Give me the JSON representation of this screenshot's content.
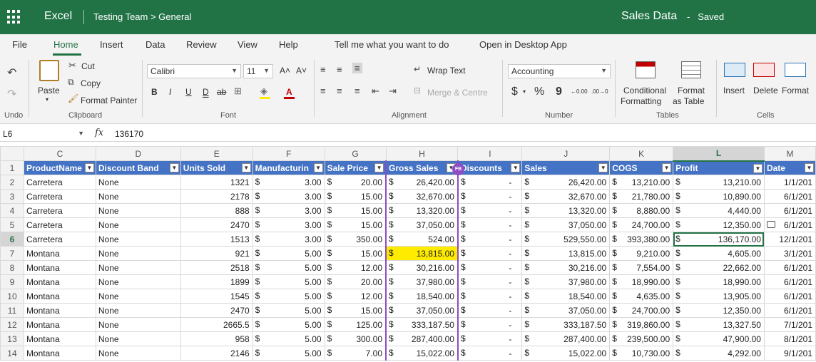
{
  "topbar": {
    "app_name": "Excel",
    "breadcrumb": "Testing Team > General",
    "doc_title": "Sales Data",
    "separator": "-",
    "status": "Saved"
  },
  "menu": {
    "tabs": [
      "File",
      "Home",
      "Insert",
      "Data",
      "Review",
      "View",
      "Help"
    ],
    "tell_me": "Tell me what you want to do",
    "open_desktop": "Open in Desktop App"
  },
  "ribbon": {
    "undo_label": "Undo",
    "paste": "Paste",
    "cut": "Cut",
    "copy": "Copy",
    "format_painter": "Format Painter",
    "clipboard_label": "Clipboard",
    "font_name": "Calibri",
    "font_size": "11",
    "font_label": "Font",
    "wrap_text": "Wrap Text",
    "merge_center": "Merge & Centre",
    "alignment_label": "Alignment",
    "number_format": "Accounting",
    "number_label": "Number",
    "conditional_formatting_1": "Conditional",
    "conditional_formatting_2": "Formatting",
    "format_as_table_1": "Format",
    "format_as_table_2": "as Table",
    "tables_label": "Tables",
    "insert": "Insert",
    "delete": "Delete",
    "format": "Format",
    "cells_label": "Cells",
    "bold": "B",
    "italic": "I",
    "underline": "U",
    "double_underline": "D",
    "strike": "ab",
    "grow_font": "A˄",
    "shrink_font": "A˅",
    "font_color": "A",
    "currency": "$",
    "percent": "%",
    "comma": "9",
    "increase_decimal": "←0.00",
    "decrease_decimal": ".00→0"
  },
  "formula_bar": {
    "name_box": "L6",
    "fx": "fx",
    "value": "136170"
  },
  "collaborator_badge": "FB",
  "grid": {
    "columns": [
      "C",
      "D",
      "E",
      "F",
      "G",
      "H",
      "I",
      "J",
      "K",
      "L",
      "M"
    ],
    "selected_col": "L",
    "selected_row": 6,
    "headers": [
      "ProductName",
      "Discount Band",
      "Units Sold",
      "Manufacturin",
      "Sale Price",
      "Gross Sales",
      "Discounts",
      "Sales",
      "COGS",
      "Profit",
      "Date"
    ],
    "rows": [
      {
        "n": "2",
        "product": "Carretera",
        "band": "None",
        "units": "1321",
        "mfg": "3.00",
        "price": "20.00",
        "gross": "26,420.00",
        "disc": "-",
        "sales": "26,420.00",
        "cogs": "13,210.00",
        "profit": "13,210.00",
        "date": "1/1/201"
      },
      {
        "n": "3",
        "product": "Carretera",
        "band": "None",
        "units": "2178",
        "mfg": "3.00",
        "price": "15.00",
        "gross": "32,670.00",
        "disc": "-",
        "sales": "32,670.00",
        "cogs": "21,780.00",
        "profit": "10,890.00",
        "date": "6/1/201"
      },
      {
        "n": "4",
        "product": "Carretera",
        "band": "None",
        "units": "888",
        "mfg": "3.00",
        "price": "15.00",
        "gross": "13,320.00",
        "disc": "-",
        "sales": "13,320.00",
        "cogs": "8,880.00",
        "profit": "4,440.00",
        "date": "6/1/201"
      },
      {
        "n": "5",
        "product": "Carretera",
        "band": "None",
        "units": "2470",
        "mfg": "3.00",
        "price": "15.00",
        "gross": "37,050.00",
        "disc": "-",
        "sales": "37,050.00",
        "cogs": "24,700.00",
        "profit": "12,350.00",
        "date": "6/1/201"
      },
      {
        "n": "6",
        "product": "Carretera",
        "band": "None",
        "units": "1513",
        "mfg": "3.00",
        "price": "350.00",
        "gross": "524.00",
        "disc": "-",
        "sales": "529,550.00",
        "cogs": "393,380.00",
        "profit": "136,170.00",
        "date": "12/1/201"
      },
      {
        "n": "7",
        "product": "Montana",
        "band": "None",
        "units": "921",
        "mfg": "5.00",
        "price": "15.00",
        "gross": "13,815.00",
        "disc": "-",
        "sales": "13,815.00",
        "cogs": "9,210.00",
        "profit": "4,605.00",
        "date": "3/1/201"
      },
      {
        "n": "8",
        "product": "Montana",
        "band": "None",
        "units": "2518",
        "mfg": "5.00",
        "price": "12.00",
        "gross": "30,216.00",
        "disc": "-",
        "sales": "30,216.00",
        "cogs": "7,554.00",
        "profit": "22,662.00",
        "date": "6/1/201"
      },
      {
        "n": "9",
        "product": "Montana",
        "band": "None",
        "units": "1899",
        "mfg": "5.00",
        "price": "20.00",
        "gross": "37,980.00",
        "disc": "-",
        "sales": "37,980.00",
        "cogs": "18,990.00",
        "profit": "18,990.00",
        "date": "6/1/201"
      },
      {
        "n": "10",
        "product": "Montana",
        "band": "None",
        "units": "1545",
        "mfg": "5.00",
        "price": "12.00",
        "gross": "18,540.00",
        "disc": "-",
        "sales": "18,540.00",
        "cogs": "4,635.00",
        "profit": "13,905.00",
        "date": "6/1/201"
      },
      {
        "n": "11",
        "product": "Montana",
        "band": "None",
        "units": "2470",
        "mfg": "5.00",
        "price": "15.00",
        "gross": "37,050.00",
        "disc": "-",
        "sales": "37,050.00",
        "cogs": "24,700.00",
        "profit": "12,350.00",
        "date": "6/1/201"
      },
      {
        "n": "12",
        "product": "Montana",
        "band": "None",
        "units": "2665.5",
        "mfg": "5.00",
        "price": "125.00",
        "gross": "333,187.50",
        "disc": "-",
        "sales": "333,187.50",
        "cogs": "319,860.00",
        "profit": "13,327.50",
        "date": "7/1/201"
      },
      {
        "n": "13",
        "product": "Montana",
        "band": "None",
        "units": "958",
        "mfg": "5.00",
        "price": "300.00",
        "gross": "287,400.00",
        "disc": "-",
        "sales": "287,400.00",
        "cogs": "239,500.00",
        "profit": "47,900.00",
        "date": "8/1/201"
      },
      {
        "n": "14",
        "product": "Montana",
        "band": "None",
        "units": "2146",
        "mfg": "5.00",
        "price": "7.00",
        "gross": "15,022.00",
        "disc": "-",
        "sales": "15,022.00",
        "cogs": "10,730.00",
        "profit": "4,292.00",
        "date": "9/1/201"
      }
    ],
    "currency_symbol": "$",
    "highlight_cell": "H7",
    "colors": {
      "header_fill": "#4472c4",
      "accent": "#217346",
      "highlight": "#ffeb00",
      "collaborator": "#8e4cc5"
    }
  }
}
